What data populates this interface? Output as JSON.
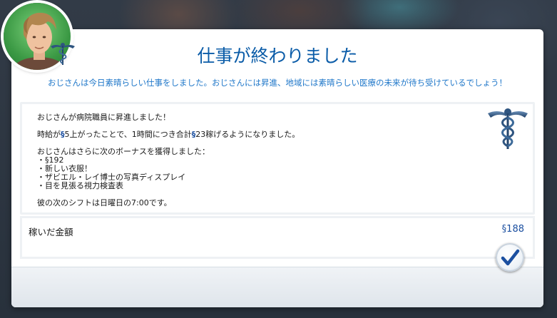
{
  "dialog": {
    "title": "仕事が終わりました",
    "subtitle": "おじさんは今日素晴らしい仕事をしました。おじさんには昇進、地域には素晴らしい医療の未来が待ち受けているでしょう！"
  },
  "body": {
    "promotion": "おじさんが病院職員に昇進しました！",
    "wage_prefix": "時給が",
    "wage_currency_1": "§",
    "wage_mid": "5上がったことで、1時間につき合計",
    "wage_currency_2": "§",
    "wage_suffix": "23稼げるようになりました。",
    "bonus_intro": "おじさんはさらに次のボーナスを獲得しました：",
    "bonus_items": [
      "・§192",
      "・新しい衣服！",
      "・ザビエル・レイ博士の写真ディスプレイ",
      "・目を見張る視力検査表"
    ],
    "next_shift": "彼の次のシフトは日曜日の7:00です。"
  },
  "earnings": {
    "label": "稼いだ金額",
    "value": "§188"
  },
  "icons": {
    "career": "caduceus-icon",
    "confirm": "checkmark-icon"
  },
  "colors": {
    "title": "#0b5ca8",
    "subtitle": "#1f77c9",
    "simoleon": "#1b4fa0",
    "avatar_bg": "#3c9a45"
  }
}
